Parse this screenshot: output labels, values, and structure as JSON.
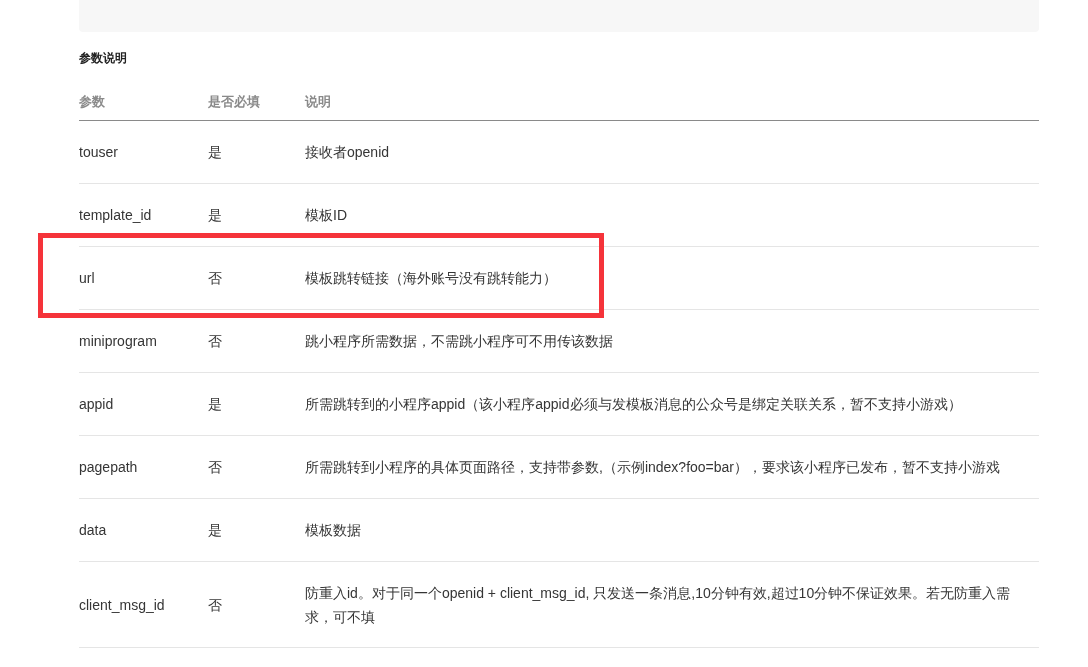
{
  "section_title": "参数说明",
  "table": {
    "columns": [
      "参数",
      "是否必填",
      "说明"
    ],
    "rows": [
      {
        "param": "touser",
        "required": "是",
        "description": "接收者openid",
        "highlighted": false
      },
      {
        "param": "template_id",
        "required": "是",
        "description": "模板ID",
        "highlighted": false
      },
      {
        "param": "url",
        "required": "否",
        "description": "模板跳转链接（海外账号没有跳转能力）",
        "highlighted": true
      },
      {
        "param": "miniprogram",
        "required": "否",
        "description": "跳小程序所需数据，不需跳小程序可不用传该数据",
        "highlighted": false
      },
      {
        "param": "appid",
        "required": "是",
        "description": "所需跳转到的小程序appid（该小程序appid必须与发模板消息的公众号是绑定关联关系，暂不支持小游戏）",
        "highlighted": false
      },
      {
        "param": "pagepath",
        "required": "否",
        "description": "所需跳转到小程序的具体页面路径，支持带参数,（示例index?foo=bar），要求该小程序已发布，暂不支持小游戏",
        "highlighted": false
      },
      {
        "param": "data",
        "required": "是",
        "description": "模板数据",
        "highlighted": false
      },
      {
        "param": "client_msg_id",
        "required": "否",
        "description": "防重入id。对于同一个openid + client_msg_id, 只发送一条消息,10分钟有效,超过10分钟不保证效果。若无防重入需求，可不填",
        "highlighted": false
      }
    ]
  }
}
